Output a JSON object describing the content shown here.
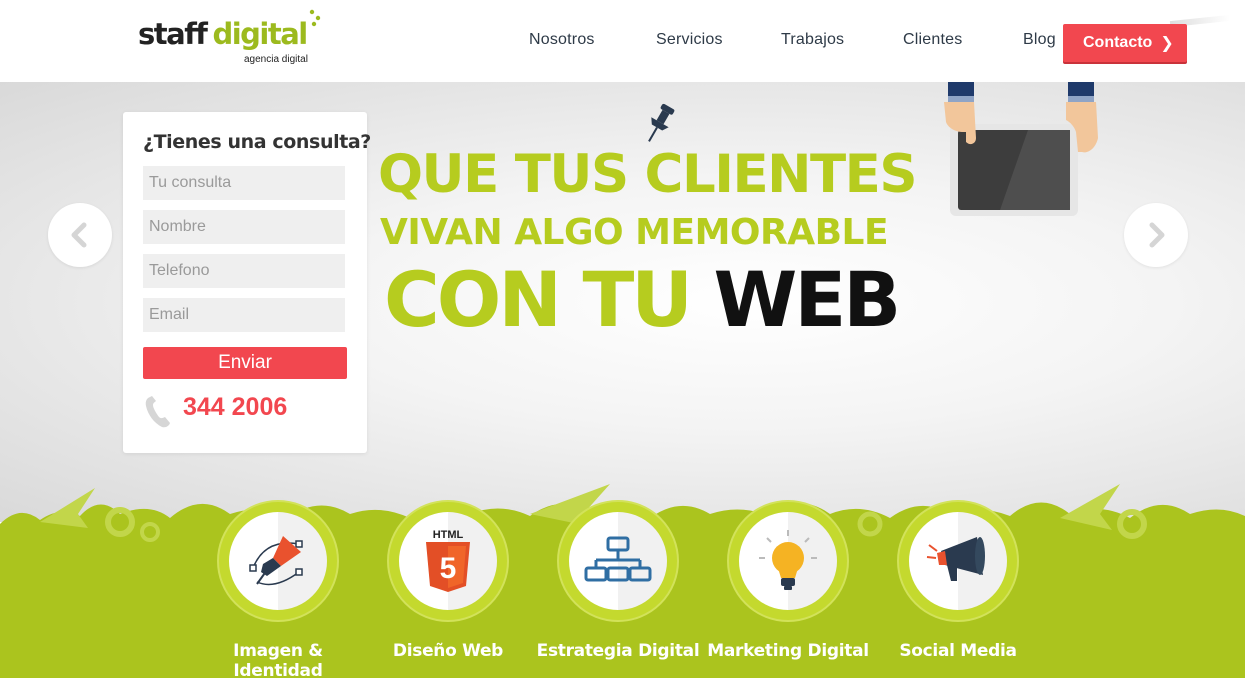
{
  "header": {
    "logo_staff": "staff",
    "logo_digital": "digital",
    "logo_sub": "agencia digital",
    "nav": [
      "Nosotros",
      "Servicios",
      "Trabajos",
      "Clientes",
      "Blog"
    ],
    "contact_label": "Contacto",
    "contact_chevron": "❯"
  },
  "colors": {
    "brand_green": "#abc41e",
    "headline_green": "#b6cc1f",
    "accent_red": "#f2474f",
    "nav_text": "#2e3a47"
  },
  "form": {
    "title": "¿Tienes una consulta?",
    "fields": [
      {
        "placeholder": "Tu consulta"
      },
      {
        "placeholder": "Nombre"
      },
      {
        "placeholder": "Telefono"
      },
      {
        "placeholder": "Email"
      }
    ],
    "submit_label": "Enviar",
    "phone": "344 2006"
  },
  "hero": {
    "line1": "QUE TUS CLIENTES",
    "line2": "VIVAN ALGO MEMORABLE",
    "line3_a": "CON TU",
    "line3_b": "WEB",
    "prev_icon": "chevron-left-icon",
    "next_icon": "chevron-right-icon"
  },
  "services": [
    {
      "label": "Imagen & Identidad",
      "icon": "pen-tool-icon"
    },
    {
      "label": "Diseño Web",
      "icon": "html5-icon",
      "icon_text": "HTML",
      "icon_badge": "5"
    },
    {
      "label": "Estrategia Digital",
      "icon": "sitemap-icon"
    },
    {
      "label": "Marketing Digital",
      "icon": "lightbulb-icon"
    },
    {
      "label": "Social Media",
      "icon": "megaphone-icon"
    }
  ]
}
